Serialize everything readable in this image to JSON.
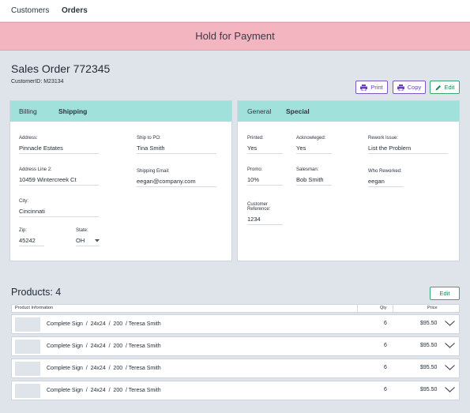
{
  "nav": {
    "items": [
      "Customers",
      "Orders"
    ],
    "active": "Orders"
  },
  "banner": {
    "text": "Hold for Payment",
    "color": "#f3b6c1"
  },
  "order": {
    "title": "Sales Order 772345",
    "customer_id": "CustomerID: M23134"
  },
  "actions": {
    "print": "Print",
    "copy": "Copy",
    "edit": "Edit"
  },
  "billing_card": {
    "tabs": [
      "Billing",
      "Shipping"
    ],
    "fields": {
      "address": {
        "label": "Address:",
        "value": "Pinnacle Estates"
      },
      "address2": {
        "label": "Address Line 2:",
        "value": "10459 Wintercreek Ct"
      },
      "city": {
        "label": "City:",
        "value": "Cincinnati"
      },
      "zip": {
        "label": "Zip:",
        "value": "45242"
      },
      "state": {
        "label": "State:",
        "value": "OH"
      },
      "ship_to_po": {
        "label": "Ship to PO:",
        "value": "Tina Smith"
      },
      "shipping_email": {
        "label": "Shipping Email:",
        "value": "eegan@company.com"
      }
    }
  },
  "general_card": {
    "tabs": [
      "General",
      "Special"
    ],
    "fields": {
      "printed": {
        "label": "Printed:",
        "value": "Yes"
      },
      "acknowledged": {
        "label": "Acknowleged:",
        "value": "Yes"
      },
      "rework_issue": {
        "label": "Rework Issue:",
        "value": "List the Problem"
      },
      "promo": {
        "label": "Promo:",
        "value": "10%"
      },
      "salesman": {
        "label": "Salesman:",
        "value": "Bob Smith"
      },
      "who_reworked": {
        "label": "Who Reworked:",
        "value": "eegan"
      },
      "customer_reference": {
        "label": "Customer Reference:",
        "value": "1234"
      }
    }
  },
  "products": {
    "title": "Products: 4",
    "edit": "Edit",
    "columns": {
      "info": "Product Information",
      "qty": "Qty",
      "price": "Price"
    },
    "rows": [
      {
        "description": "Complete Sign  /  24x24  /  200  / Teresa Smith",
        "qty": "6",
        "price": "$95.50"
      },
      {
        "description": "Complete Sign  /  24x24  /  200  / Teresa Smith",
        "qty": "6",
        "price": "$95.50"
      },
      {
        "description": "Complete Sign  /  24x24  /  200  / Teresa Smith",
        "qty": "6",
        "price": "$95.50"
      },
      {
        "description": "Complete Sign  /  24x24  /  200  / Teresa Smith",
        "qty": "6",
        "price": "$95.50"
      }
    ]
  },
  "colors": {
    "accent_teal": "#a0e1dc",
    "print_purple": "#7e57c2",
    "edit_green": "#3aa86e"
  },
  "icons": {
    "print": "printer-icon",
    "copy": "copy-icon",
    "edit": "pencil-icon",
    "expand": "chevron-down-icon",
    "select": "caret-down-icon"
  }
}
